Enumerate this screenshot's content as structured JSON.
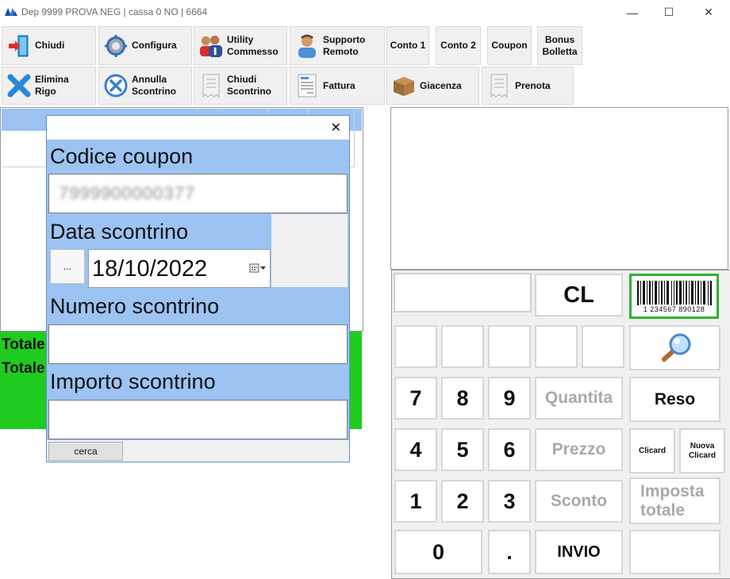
{
  "window": {
    "title": "Dep 9999 PROVA NEG | cassa 0 NO  | 6664",
    "controls": {
      "minimize": "—",
      "maximize": "☐",
      "close": "✕"
    }
  },
  "toolbar_row1": [
    {
      "id": "chiudi",
      "label": "Chiudi",
      "icon": "exit-door-icon"
    },
    {
      "id": "configura",
      "label": "Configura",
      "icon": "gear-icon"
    },
    {
      "id": "utility",
      "label": "Utility\nCommesso",
      "icon": "users-icon"
    },
    {
      "id": "supporto",
      "label": "Supporto\nRemoto",
      "icon": "support-person-icon"
    },
    {
      "id": "conto1",
      "label": "Conto 1"
    },
    {
      "id": "conto2",
      "label": "Conto 2"
    },
    {
      "id": "coupon",
      "label": "Coupon"
    },
    {
      "id": "bonus",
      "label": "Bonus\nBolletta"
    }
  ],
  "toolbar_row2": [
    {
      "id": "elimina",
      "label": "Elimina\nRigo",
      "icon": "delete-x-icon"
    },
    {
      "id": "annulla",
      "label": "Annulla\nScontrino",
      "icon": "cancel-circle-icon"
    },
    {
      "id": "chiudi_scontrino",
      "label": "Chiudi\nScontrino",
      "icon": "receipt-icon"
    },
    {
      "id": "fattura",
      "label": "Fattura",
      "icon": "invoice-icon"
    },
    {
      "id": "giacenza",
      "label": "Giacenza",
      "icon": "box-icon"
    },
    {
      "id": "prenota",
      "label": "Prenota",
      "icon": "receipt-icon"
    }
  ],
  "totals": {
    "line1": "Totale",
    "line2": "Totale"
  },
  "dialog": {
    "close": "✕",
    "coupon_label": "Codice coupon",
    "coupon_value": "7999900000377",
    "date_label": "Data scontrino",
    "dots": "...",
    "date_value": "18/10/2022",
    "numero_label": "Numero scontrino",
    "importo_label": "Importo scontrino",
    "cerca": "cerca"
  },
  "keypad": {
    "cl": "CL",
    "barcode_text": "1  234567  890128",
    "k7": "7",
    "k8": "8",
    "k9": "9",
    "k4": "4",
    "k5": "5",
    "k6": "6",
    "k1": "1",
    "k2": "2",
    "k3": "3",
    "k0": "0",
    "dot": ".",
    "quantita": "Quantita",
    "prezzo": "Prezzo",
    "sconto": "Sconto",
    "invio": "INVIO",
    "reso": "Reso",
    "clicard": "Clicard",
    "nuova_clicard": "Nuova\nClicard",
    "imposta_totale": "Imposta\ntotale"
  },
  "colors": {
    "accent_blue": "#9cc3f2",
    "totals_green": "#1fcc1f",
    "barcode_border": "#2fb52f",
    "disabled_text": "#a9a9a9"
  }
}
